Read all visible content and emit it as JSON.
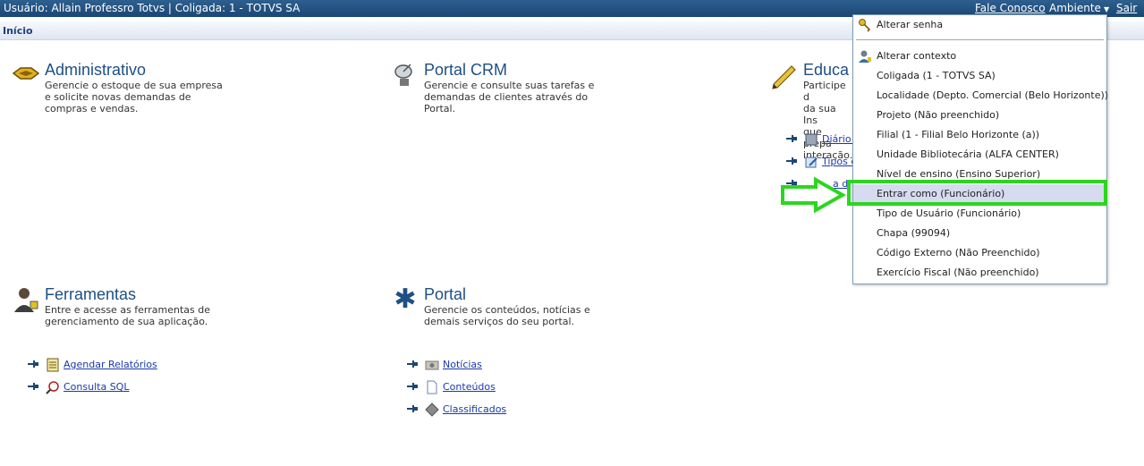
{
  "topbar": {
    "user_info": "Usuário: Allain Professro Totvs  |  Coligada: 1 - TOTVS SA",
    "contact_link": "Fale Conosco",
    "environment_menu": "Ambiente",
    "logout_link": "Sair"
  },
  "breadcrumb": "Início",
  "modules": {
    "administrativo": {
      "title": "Administrativo",
      "lines": [
        "Gerencie o estoque de sua empresa",
        "e solicite novas demandas de",
        "compras e vendas."
      ]
    },
    "crm": {
      "title": "Portal CRM",
      "lines": [
        "Gerencie e consulte suas tarefas e",
        "demandas de clientes através do",
        "Portal."
      ]
    },
    "educacional": {
      "title": "Educa",
      "lines": [
        "Participe d",
        "da sua Ins",
        "que prepa",
        "interação."
      ],
      "links": [
        "Diário d",
        "Tipos d",
        "a d"
      ]
    },
    "ferramentas": {
      "title": "Ferramentas",
      "lines": [
        "Entre e acesse as ferramentas de",
        "gerenciamento de sua aplicação."
      ],
      "links": [
        "Agendar Relatórios",
        "Consulta SQL"
      ]
    },
    "portal": {
      "title": "Portal",
      "lines": [
        "Gerencie os conteúdos, notícias e",
        "demais serviços do seu portal."
      ],
      "links": [
        "Notícias",
        "Conteúdos",
        "Classificados"
      ]
    }
  },
  "dropdown": {
    "change_password": "Alterar senha",
    "change_context": "Alterar contexto",
    "items": [
      "Coligada (1 - TOTVS SA)",
      "Localidade (Depto. Comercial (Belo Horizonte))",
      "Projeto (Não preenchido)",
      "Filial (1 - Filial Belo Horizonte (a))",
      "Unidade Bibliotecária (ALFA CENTER)",
      "Nível de ensino (Ensino Superior)",
      "Entrar como (Funcionário)",
      "Tipo de Usuário (Funcionário)",
      "Chapa (99094)",
      "Código Externo (Não Preenchido)",
      "Exercício Fiscal (Não preenchido)"
    ],
    "selected_index": 6
  },
  "colors": {
    "topbar": "#1b4774",
    "module_title": "#1e4f84",
    "link": "#1a39a8",
    "highlight": "#2bd61f",
    "selected_item": "#d6dbef"
  }
}
